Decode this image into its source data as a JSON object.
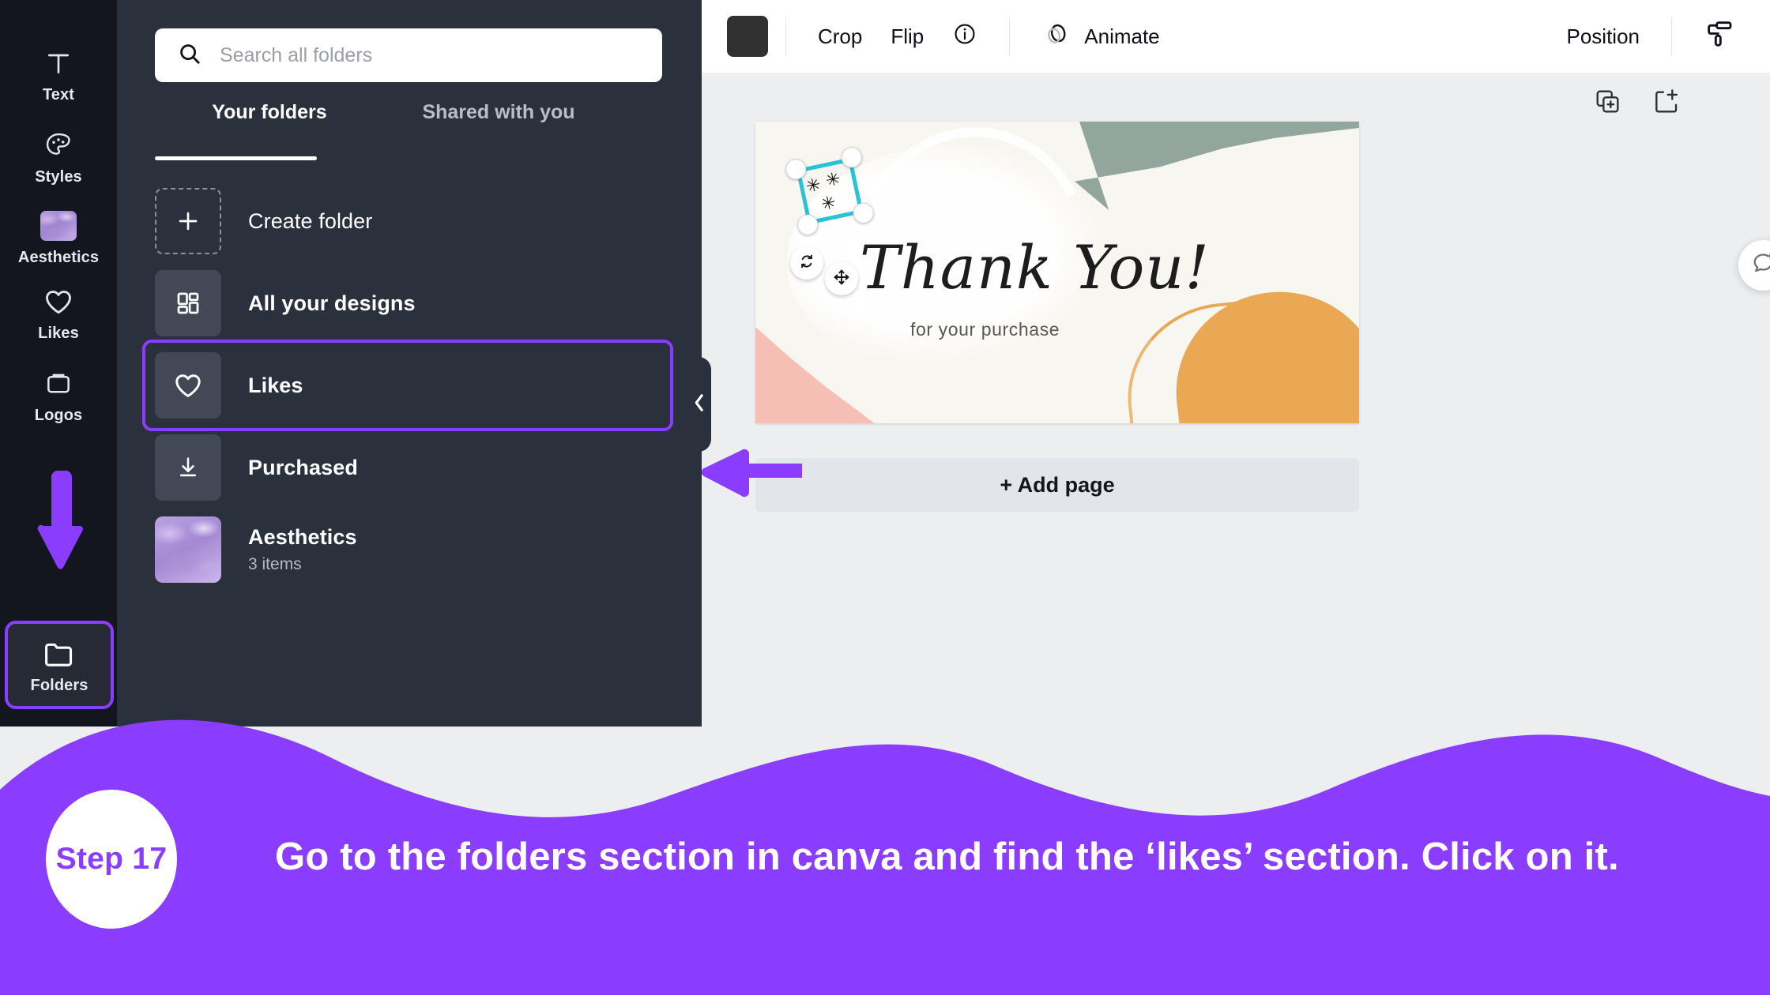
{
  "app": {
    "accent_purple": "#8b3dff",
    "rail_bg": "#13161f",
    "panel_bg": "#2b303d",
    "workspace_bg": "#eceef0",
    "selection_cyan": "#29c2d6"
  },
  "rail": {
    "items": [
      {
        "label": "Text",
        "icon": "text-icon"
      },
      {
        "label": "Styles",
        "icon": "palette-icon"
      },
      {
        "label": "Aesthetics",
        "icon": "aesthetics-thumbnail"
      },
      {
        "label": "Likes",
        "icon": "heart-icon"
      },
      {
        "label": "Logos",
        "icon": "logos-icon"
      },
      {
        "label": "Folders",
        "icon": "folder-icon"
      }
    ],
    "selected": "Folders"
  },
  "panel": {
    "search": {
      "placeholder": "Search all folders",
      "value": "",
      "icon": "search-icon"
    },
    "tabs": [
      {
        "label": "Your folders",
        "active": true
      },
      {
        "label": "Shared with you",
        "active": false
      }
    ],
    "folders": [
      {
        "title": "Create folder",
        "sub": "",
        "icon": "plus-icon"
      },
      {
        "title": "All your designs",
        "sub": "",
        "icon": "grid-icon"
      },
      {
        "title": "Likes",
        "sub": "",
        "icon": "heart-icon",
        "selected": true
      },
      {
        "title": "Purchased",
        "sub": "",
        "icon": "download-icon"
      },
      {
        "title": "Aesthetics",
        "sub": "3 items",
        "icon": "aesthetics-thumbnail"
      }
    ],
    "collapse_icon": "chevron-left-icon"
  },
  "toolbar": {
    "color_swatch": "#303030",
    "crop_label": "Crop",
    "flip_label": "Flip",
    "info_icon": "info-icon",
    "animate_label": "Animate",
    "animate_icon": "animate-icon",
    "position_label": "Position",
    "tune_icon": "paint-roller-icon"
  },
  "canvas": {
    "duplicate_page_icon": "duplicate-page-icon",
    "add_page_icon": "add-page-icon",
    "comment_icon": "add-comment-icon",
    "design": {
      "title": "Thank You!",
      "subtitle": "for your purchase",
      "rotate_icon": "rotate-icon",
      "move_icon": "move-icon",
      "sparkles": [
        "✳",
        "✳",
        "✳"
      ]
    },
    "add_page_label": "+ Add page"
  },
  "banner": {
    "step_label": "Step 17",
    "instruction": "Go to the folders section in canva and find the ‘likes’ section. Click on it.",
    "bg_color": "#8b3dff"
  }
}
